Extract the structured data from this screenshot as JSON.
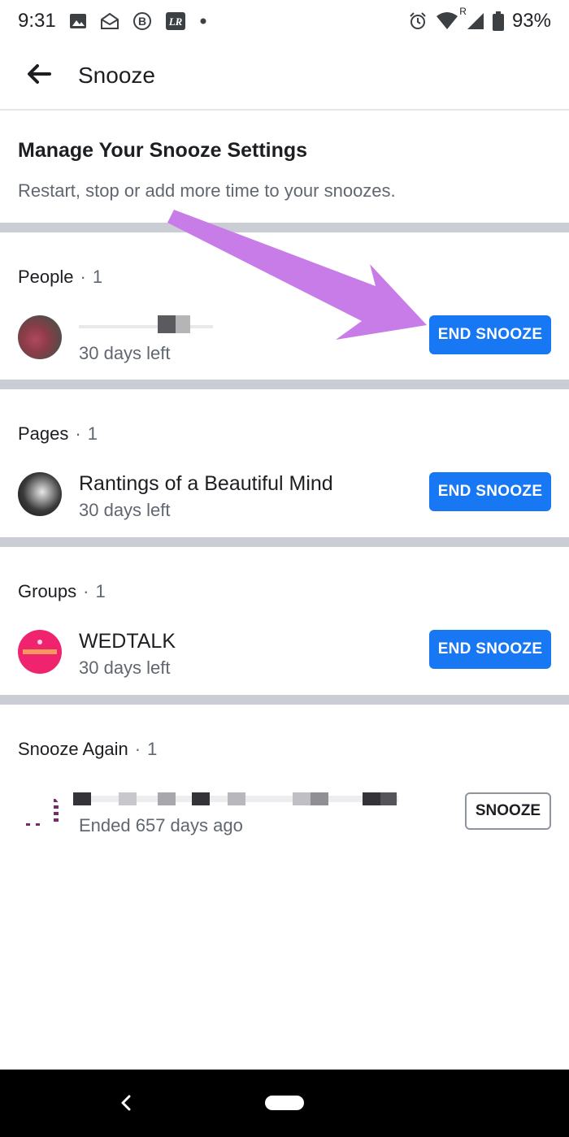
{
  "status_bar": {
    "time": "9:31",
    "battery": "93%",
    "roaming": "R"
  },
  "app_bar": {
    "title": "Snooze"
  },
  "intro": {
    "title": "Manage Your Snooze Settings",
    "subtitle": "Restart, stop or add more time to your snoozes."
  },
  "sections": {
    "people": {
      "name": "People",
      "dot": "·",
      "count": "1",
      "item": {
        "subtitle": "30 days left",
        "button": "END SNOOZE"
      }
    },
    "pages": {
      "name": "Pages",
      "dot": "·",
      "count": "1",
      "item": {
        "title": "Rantings of a Beautiful Mind",
        "subtitle": "30 days left",
        "button": "END SNOOZE"
      }
    },
    "groups": {
      "name": "Groups",
      "dot": "·",
      "count": "1",
      "item": {
        "title": "WEDTALK",
        "subtitle": "30 days left",
        "button": "END SNOOZE"
      }
    },
    "snooze_again": {
      "name": "Snooze Again",
      "dot": "·",
      "count": "1",
      "item": {
        "subtitle": "Ended 657 days ago",
        "button": "SNOOZE"
      }
    }
  },
  "colors": {
    "accent": "#1877f2",
    "annotation_arrow": "#c77ce8",
    "divider": "#cacdd4"
  },
  "icons": [
    "image-icon",
    "mail-icon",
    "b-icon",
    "lr-icon",
    "alarm-icon",
    "wifi-icon",
    "signal-icon",
    "battery-icon",
    "back-arrow-icon"
  ]
}
